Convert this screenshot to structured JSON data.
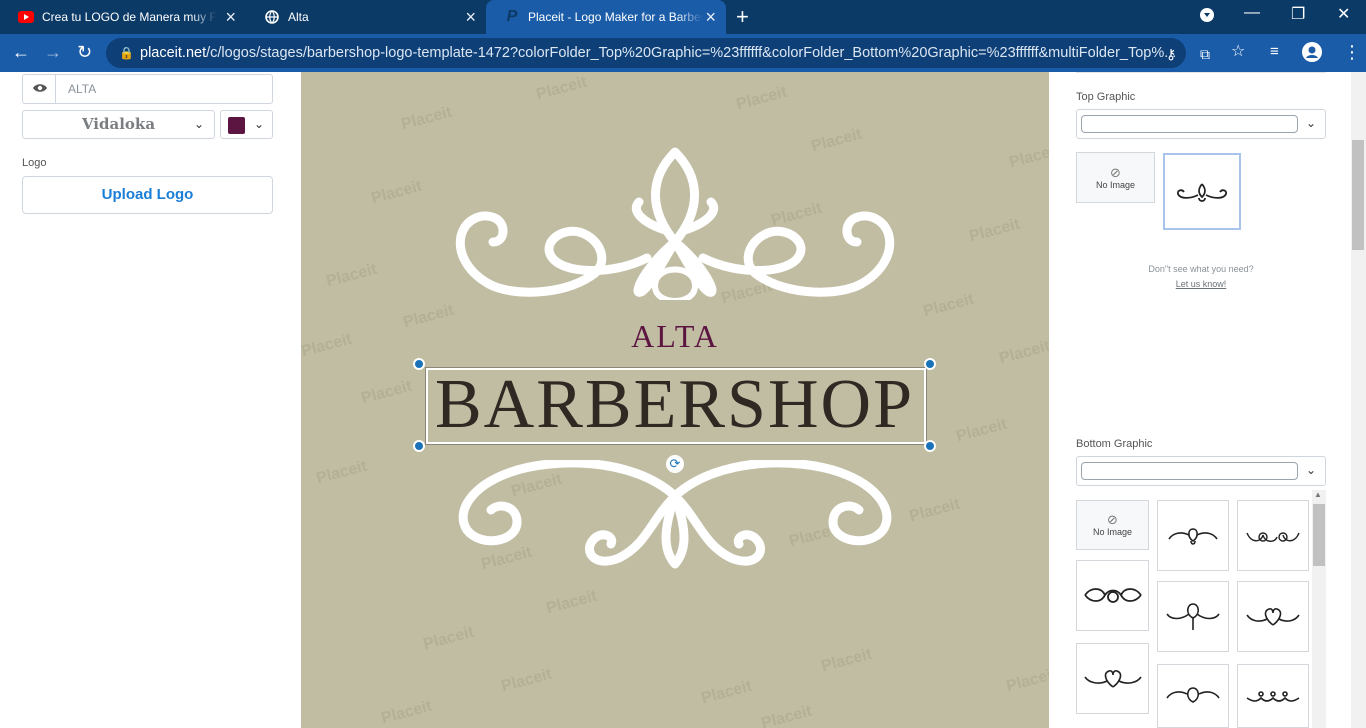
{
  "browser": {
    "tabs": [
      {
        "title": "Crea tu LOGO de Manera muy FÁCIL",
        "icon": "youtube-icon"
      },
      {
        "title": "Alta",
        "icon": "globe-icon"
      },
      {
        "title": "Placeit - Logo Maker for a Barbershop",
        "icon": "placeit-icon",
        "active": true
      }
    ],
    "url_host": "placeit.net",
    "url_path": "/c/logos/stages/barbershop-logo-template-1472?colorFolder_Top%20Graphic=%23ffffff&colorFolder_Bottom%20Graphic=%23ffffff&multiFolder_Top%..."
  },
  "left_panel": {
    "text_value": "ALTA",
    "font_name": "Vidaloka",
    "text_color": "#5c1440",
    "logo_label": "Logo",
    "upload_label": "Upload Logo"
  },
  "canvas": {
    "bg_color": "#c1bda3",
    "watermark": "Placeit",
    "top_text": "ALTA",
    "main_text": "BARBERSHOP"
  },
  "right_panel": {
    "top_graphic_label": "Top Graphic",
    "bottom_graphic_label": "Bottom Graphic",
    "no_image_label": "No Image",
    "help_text": "Don\"t see what you need?",
    "help_link": "Let us know!"
  }
}
